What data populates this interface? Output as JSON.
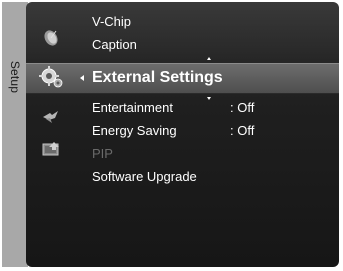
{
  "left_tab": {
    "label": "Setup"
  },
  "menu": {
    "items_above": [
      {
        "label": "V-Chip"
      },
      {
        "label": "Caption"
      }
    ],
    "selected": {
      "label": "External Settings"
    },
    "items_below": [
      {
        "label": "Entertainment",
        "value": ": Off"
      },
      {
        "label": "Energy Saving",
        "value": ": Off"
      },
      {
        "label": "PIP",
        "state": "disabled"
      },
      {
        "label": "Software Upgrade"
      }
    ]
  },
  "icons": {
    "category_icons": [
      "satellite-dish-icon",
      "gear-setup-icon",
      "sound-speaker-icon",
      "input-source-icon"
    ]
  },
  "colors": {
    "panel_background": "#1e1e1e",
    "selected_bar": "#5a5a5a",
    "left_tab": "#a8a8a8",
    "disabled_text": "#6a6a6a"
  }
}
